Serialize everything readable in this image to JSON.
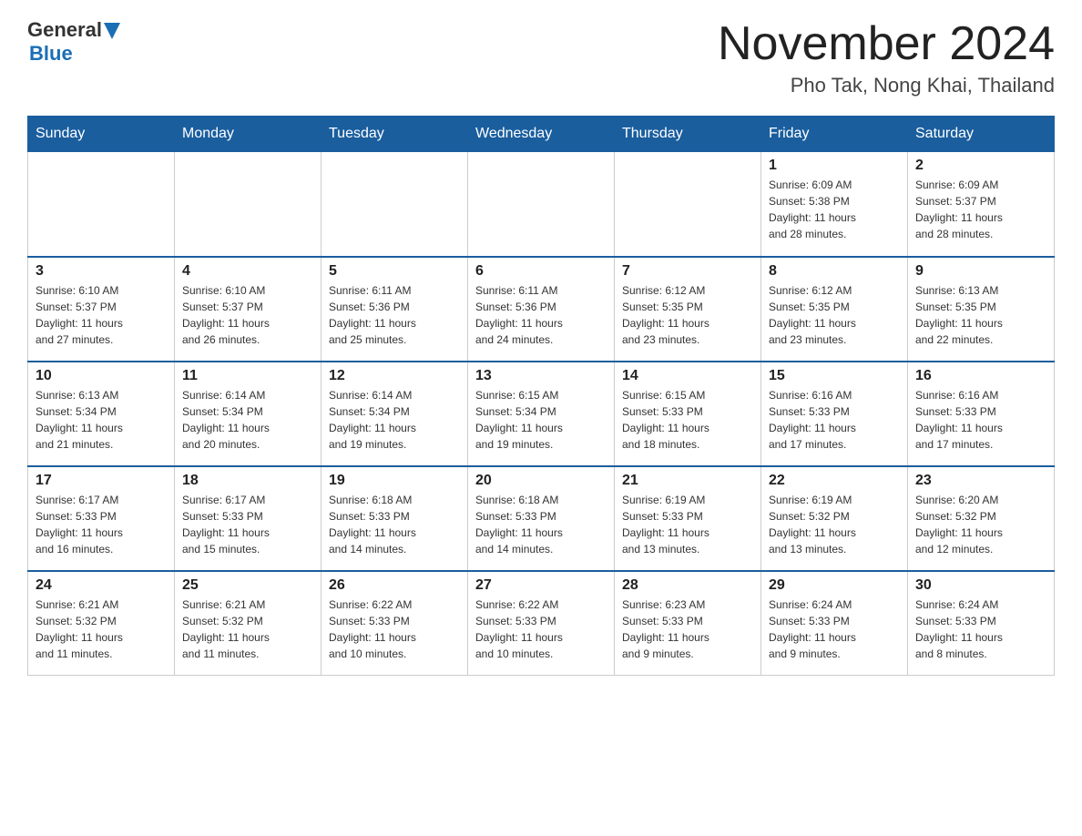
{
  "header": {
    "logo_general": "General",
    "logo_blue": "Blue",
    "month_title": "November 2024",
    "location": "Pho Tak, Nong Khai, Thailand"
  },
  "days": [
    "Sunday",
    "Monday",
    "Tuesday",
    "Wednesday",
    "Thursday",
    "Friday",
    "Saturday"
  ],
  "weeks": [
    [
      {
        "date": "",
        "info": ""
      },
      {
        "date": "",
        "info": ""
      },
      {
        "date": "",
        "info": ""
      },
      {
        "date": "",
        "info": ""
      },
      {
        "date": "",
        "info": ""
      },
      {
        "date": "1",
        "info": "Sunrise: 6:09 AM\nSunset: 5:38 PM\nDaylight: 11 hours\nand 28 minutes."
      },
      {
        "date": "2",
        "info": "Sunrise: 6:09 AM\nSunset: 5:37 PM\nDaylight: 11 hours\nand 28 minutes."
      }
    ],
    [
      {
        "date": "3",
        "info": "Sunrise: 6:10 AM\nSunset: 5:37 PM\nDaylight: 11 hours\nand 27 minutes."
      },
      {
        "date": "4",
        "info": "Sunrise: 6:10 AM\nSunset: 5:37 PM\nDaylight: 11 hours\nand 26 minutes."
      },
      {
        "date": "5",
        "info": "Sunrise: 6:11 AM\nSunset: 5:36 PM\nDaylight: 11 hours\nand 25 minutes."
      },
      {
        "date": "6",
        "info": "Sunrise: 6:11 AM\nSunset: 5:36 PM\nDaylight: 11 hours\nand 24 minutes."
      },
      {
        "date": "7",
        "info": "Sunrise: 6:12 AM\nSunset: 5:35 PM\nDaylight: 11 hours\nand 23 minutes."
      },
      {
        "date": "8",
        "info": "Sunrise: 6:12 AM\nSunset: 5:35 PM\nDaylight: 11 hours\nand 23 minutes."
      },
      {
        "date": "9",
        "info": "Sunrise: 6:13 AM\nSunset: 5:35 PM\nDaylight: 11 hours\nand 22 minutes."
      }
    ],
    [
      {
        "date": "10",
        "info": "Sunrise: 6:13 AM\nSunset: 5:34 PM\nDaylight: 11 hours\nand 21 minutes."
      },
      {
        "date": "11",
        "info": "Sunrise: 6:14 AM\nSunset: 5:34 PM\nDaylight: 11 hours\nand 20 minutes."
      },
      {
        "date": "12",
        "info": "Sunrise: 6:14 AM\nSunset: 5:34 PM\nDaylight: 11 hours\nand 19 minutes."
      },
      {
        "date": "13",
        "info": "Sunrise: 6:15 AM\nSunset: 5:34 PM\nDaylight: 11 hours\nand 19 minutes."
      },
      {
        "date": "14",
        "info": "Sunrise: 6:15 AM\nSunset: 5:33 PM\nDaylight: 11 hours\nand 18 minutes."
      },
      {
        "date": "15",
        "info": "Sunrise: 6:16 AM\nSunset: 5:33 PM\nDaylight: 11 hours\nand 17 minutes."
      },
      {
        "date": "16",
        "info": "Sunrise: 6:16 AM\nSunset: 5:33 PM\nDaylight: 11 hours\nand 17 minutes."
      }
    ],
    [
      {
        "date": "17",
        "info": "Sunrise: 6:17 AM\nSunset: 5:33 PM\nDaylight: 11 hours\nand 16 minutes."
      },
      {
        "date": "18",
        "info": "Sunrise: 6:17 AM\nSunset: 5:33 PM\nDaylight: 11 hours\nand 15 minutes."
      },
      {
        "date": "19",
        "info": "Sunrise: 6:18 AM\nSunset: 5:33 PM\nDaylight: 11 hours\nand 14 minutes."
      },
      {
        "date": "20",
        "info": "Sunrise: 6:18 AM\nSunset: 5:33 PM\nDaylight: 11 hours\nand 14 minutes."
      },
      {
        "date": "21",
        "info": "Sunrise: 6:19 AM\nSunset: 5:33 PM\nDaylight: 11 hours\nand 13 minutes."
      },
      {
        "date": "22",
        "info": "Sunrise: 6:19 AM\nSunset: 5:32 PM\nDaylight: 11 hours\nand 13 minutes."
      },
      {
        "date": "23",
        "info": "Sunrise: 6:20 AM\nSunset: 5:32 PM\nDaylight: 11 hours\nand 12 minutes."
      }
    ],
    [
      {
        "date": "24",
        "info": "Sunrise: 6:21 AM\nSunset: 5:32 PM\nDaylight: 11 hours\nand 11 minutes."
      },
      {
        "date": "25",
        "info": "Sunrise: 6:21 AM\nSunset: 5:32 PM\nDaylight: 11 hours\nand 11 minutes."
      },
      {
        "date": "26",
        "info": "Sunrise: 6:22 AM\nSunset: 5:33 PM\nDaylight: 11 hours\nand 10 minutes."
      },
      {
        "date": "27",
        "info": "Sunrise: 6:22 AM\nSunset: 5:33 PM\nDaylight: 11 hours\nand 10 minutes."
      },
      {
        "date": "28",
        "info": "Sunrise: 6:23 AM\nSunset: 5:33 PM\nDaylight: 11 hours\nand 9 minutes."
      },
      {
        "date": "29",
        "info": "Sunrise: 6:24 AM\nSunset: 5:33 PM\nDaylight: 11 hours\nand 9 minutes."
      },
      {
        "date": "30",
        "info": "Sunrise: 6:24 AM\nSunset: 5:33 PM\nDaylight: 11 hours\nand 8 minutes."
      }
    ]
  ]
}
